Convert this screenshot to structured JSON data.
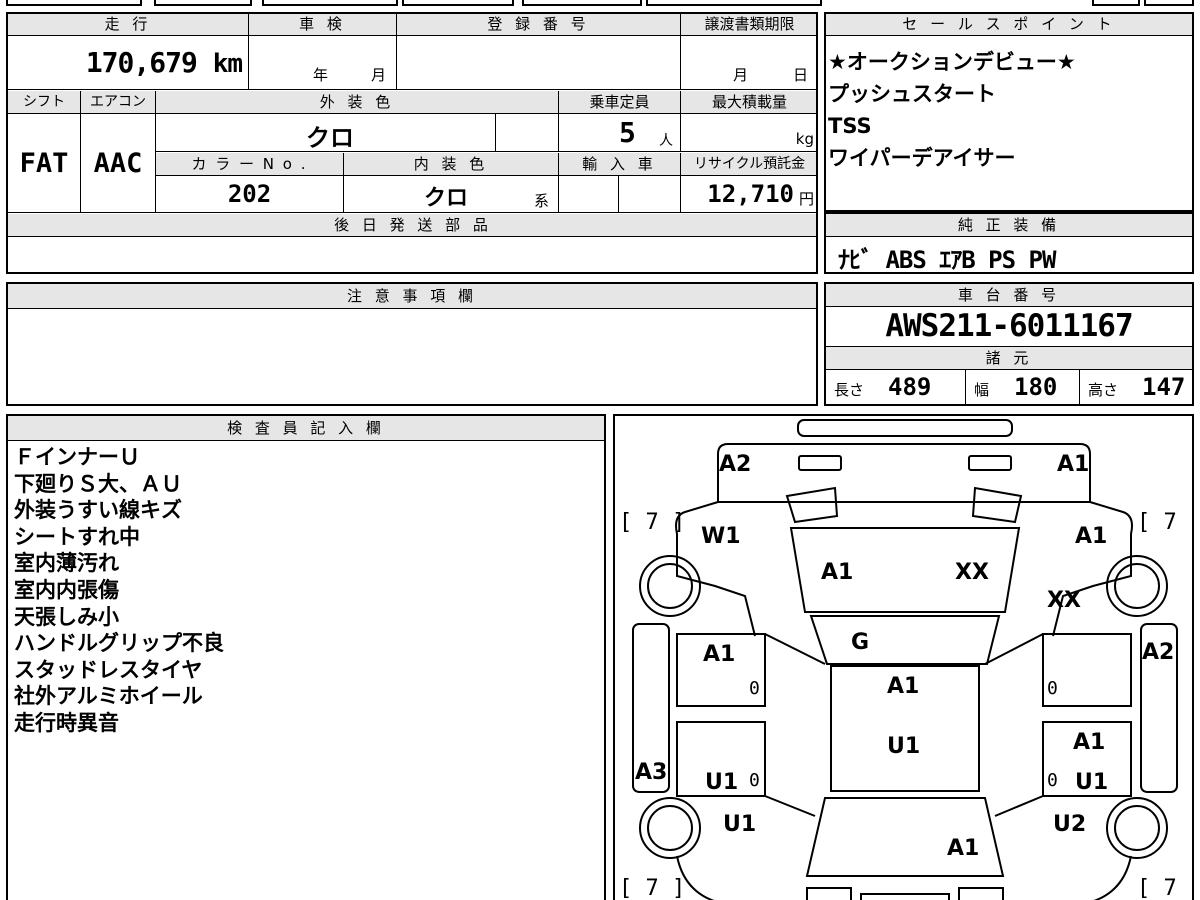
{
  "vehicle": {
    "mileage_label": "走 行",
    "mileage": "170,679",
    "mileage_unit": "km",
    "inspection_label": "車 検",
    "year_unit": "年",
    "month_unit": "月",
    "registration_label": "登 録 番 号",
    "transfer_label": "譲渡書類期限",
    "transfer_month": "月",
    "transfer_day": "日",
    "shift_label": "シフト",
    "shift": "FAT",
    "ac_label": "エアコン",
    "ac": "AAC",
    "exterior_color_label": "外 装 色",
    "exterior_color": "クロ",
    "capacity_label": "乗車定員",
    "capacity": "5",
    "capacity_unit": "人",
    "max_load_label": "最大積載量",
    "max_load_unit": "kg",
    "color_no_label": "カ ラ ー N o .",
    "color_no": "202",
    "interior_color_label": "内 装 色",
    "interior_color": "クロ",
    "interior_suffix": "系",
    "import_label": "輸 入 車",
    "recycle_label": "リサイクル預託金",
    "recycle_fee": "12,710",
    "recycle_unit": "円",
    "later_parts_label": "後 日 発 送 部 品"
  },
  "sales_points": {
    "label": "セ ー ル ス ポ イ ン ト",
    "items": [
      "★オークションデビュー★",
      "プッシュスタート",
      "TSS",
      "ワイパーデアイサー"
    ]
  },
  "equipment": {
    "label": "純 正 装 備",
    "text": "ﾅﾋﾞ ABS ｴｱB PS PW"
  },
  "notes": {
    "label": "注 意 事 項 欄"
  },
  "chassis": {
    "label": "車 台 番 号",
    "number": "AWS211-6011167",
    "specs_label": "諸 元",
    "length_label": "長さ",
    "length": "489",
    "width_label": "幅",
    "width": "180",
    "height_label": "高さ",
    "height": "147"
  },
  "inspector": {
    "label": "検 査 員 記 入 欄",
    "lines": [
      "ＦインナーＵ",
      "下廻りＳ大、ＡＵ",
      "外装うすい線キズ",
      "シートすれ中",
      "室内薄汚れ",
      "室内内張傷",
      "天張しみ小",
      "ハンドルグリップ不良",
      "スタッドレスタイヤ",
      "社外アルミホイール",
      "走行時異音"
    ]
  },
  "diagram": {
    "tire_depth": "7",
    "zero": "0",
    "labels": {
      "front_left_corner": "A2",
      "front_right_corner": "A1",
      "left_front_fender": "W1",
      "right_front_fender": "A1",
      "hood_left": "A1",
      "hood_right": "XX",
      "right_fender_lower": "XX",
      "windshield": "G",
      "left_front_door": "A1",
      "right_pillar": "A2",
      "roof": "A1",
      "roof_rear": "U1",
      "left_rear_door": "U1",
      "right_rear_door": "A1",
      "right_rear_door_lower": "U1",
      "left_sill": "A3",
      "left_rear_fender": "U1",
      "right_rear_fender": "U2",
      "trunk": "A1"
    }
  }
}
